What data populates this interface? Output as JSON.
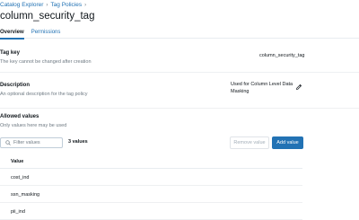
{
  "breadcrumb": {
    "items": [
      "Catalog Explorer",
      "Tag Policies"
    ],
    "separator": "›"
  },
  "title": "column_security_tag",
  "tabs": [
    {
      "label": "Overview",
      "active": true
    },
    {
      "label": "Permissions",
      "active": false
    }
  ],
  "tag_key": {
    "label": "Tag key",
    "help": "The key cannot be changed after creation",
    "value": "column_security_tag"
  },
  "description": {
    "label": "Description",
    "help": "An optional description for the tag policy",
    "value_line1": "Used for Column Level Data",
    "value_line2": "Masking",
    "edit_icon": "pencil-icon"
  },
  "allowed_values": {
    "label": "Allowed values",
    "help": "Only values here may be used",
    "filter_placeholder": "Filter values",
    "count": "3 values",
    "remove_button": "Remove value",
    "add_button": "Add value",
    "column_header": "Value",
    "rows": [
      "cost_ind",
      "ssn_masking",
      "pii_ind"
    ]
  },
  "colors": {
    "accent": "#2272b4",
    "muted_text": "#6f7a83"
  }
}
